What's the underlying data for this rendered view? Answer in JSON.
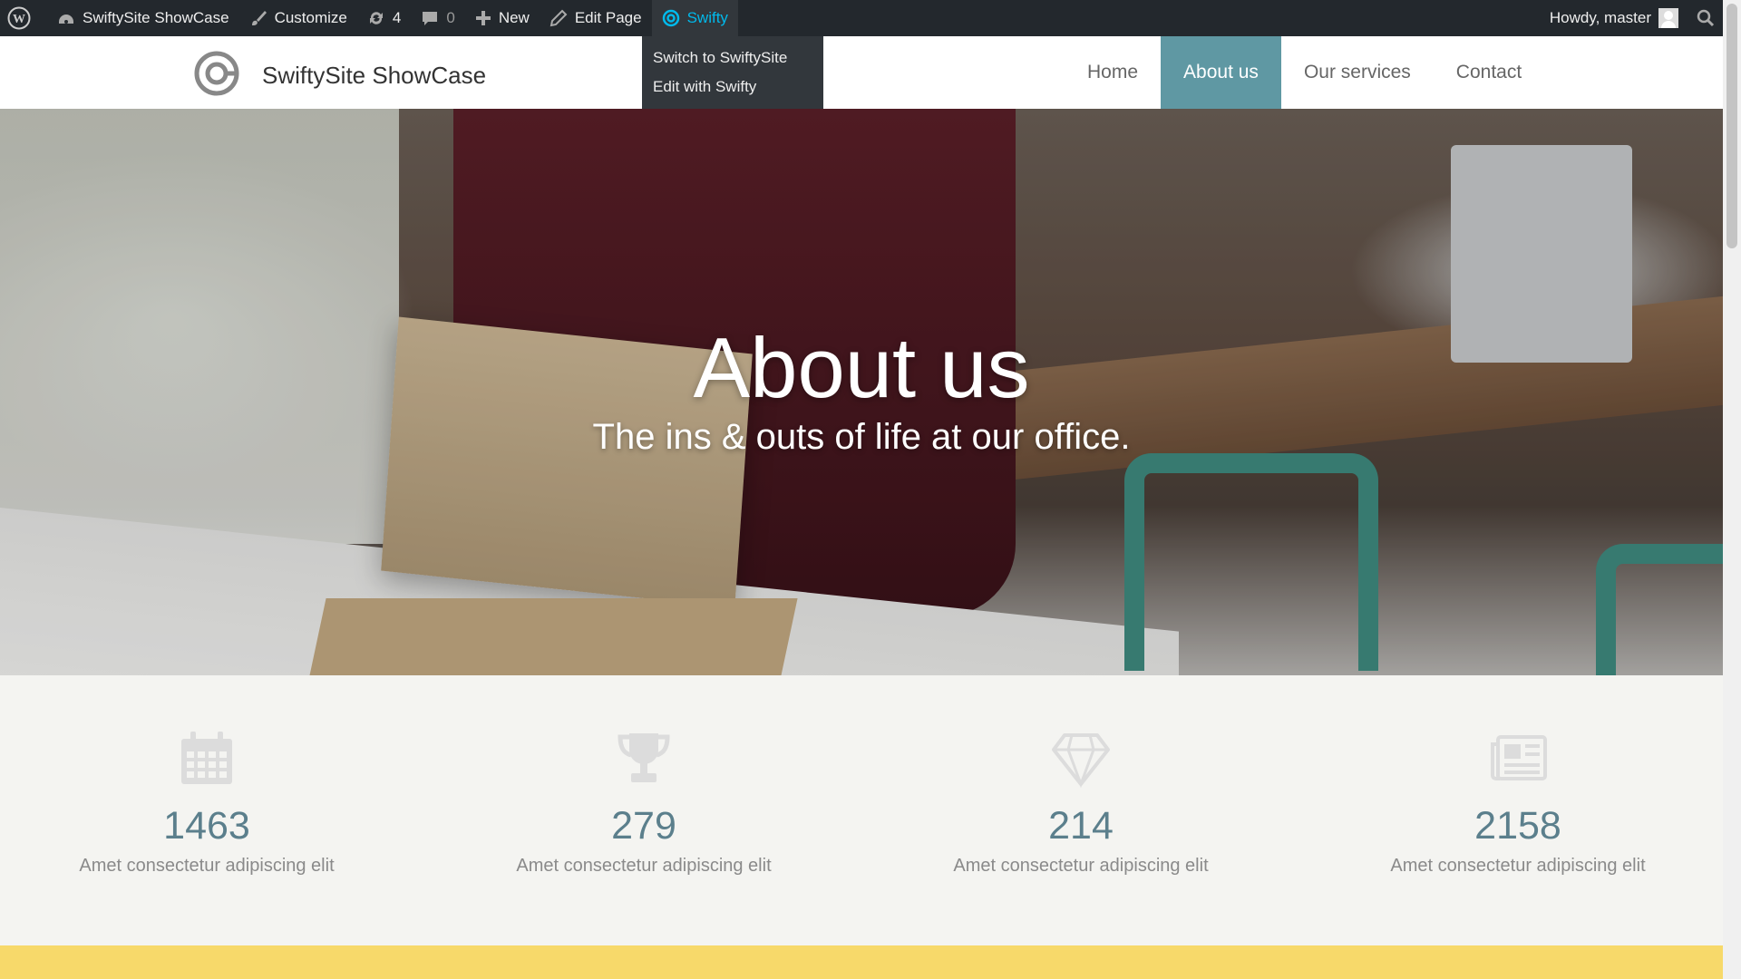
{
  "adminbar": {
    "site_name": "SwiftySite ShowCase",
    "customize": "Customize",
    "updates_count": "4",
    "comments_count": "0",
    "new": "New",
    "edit_page": "Edit Page",
    "swifty": "Swifty",
    "greeting": "Howdy, master"
  },
  "swifty_menu": {
    "items": [
      "Switch to SwiftySite",
      "Edit with Swifty"
    ]
  },
  "header": {
    "site_title": "SwiftySite ShowCase",
    "nav": [
      "Home",
      "About us",
      "Our services",
      "Contact"
    ],
    "active_nav": "About us"
  },
  "hero": {
    "title": "About us",
    "subtitle": "The ins & outs of life at our office."
  },
  "stats": [
    {
      "icon": "calendar-icon",
      "value": "1463",
      "label": "Amet consectetur adipiscing elit"
    },
    {
      "icon": "trophy-icon",
      "value": "279",
      "label": "Amet consectetur adipiscing elit"
    },
    {
      "icon": "diamond-icon",
      "value": "214",
      "label": "Amet consectetur adipiscing elit"
    },
    {
      "icon": "newspaper-icon",
      "value": "2158",
      "label": "Amet consectetur adipiscing elit"
    }
  ],
  "colors": {
    "adminbar_bg": "#23282d",
    "swifty_accent": "#00b9eb",
    "nav_active": "#5f98a3",
    "stat_number": "#5b7f8c",
    "band": "#f7d96a"
  }
}
